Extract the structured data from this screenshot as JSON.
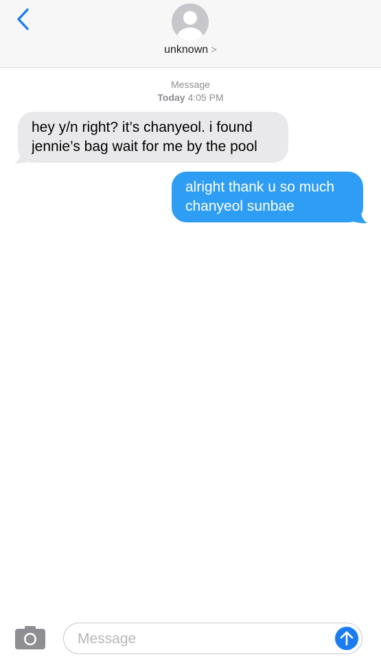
{
  "header": {
    "back_icon": "chevron-left-icon",
    "avatar_icon": "person-silhouette-icon",
    "contact_name": "unknown",
    "contact_chevron": ">"
  },
  "conversation": {
    "service": "Message",
    "date_label": "Today",
    "time_label": "4:05 PM",
    "messages": [
      {
        "direction": "incoming",
        "lines": [
          "hey y/n right? it’s chanyeol. i found",
          "jennie’s bag wait for me by the pool"
        ]
      },
      {
        "direction": "outgoing",
        "lines": [
          "alright thank u so much",
          "chanyeol sunbae"
        ]
      }
    ]
  },
  "composer": {
    "camera_icon": "camera-icon",
    "placeholder": "Message",
    "send_icon": "arrow-up-icon"
  },
  "colors": {
    "accent": "#1b7cf2",
    "outgoing_bubble": "#2e9df4",
    "incoming_bubble": "#e9e9eb"
  }
}
